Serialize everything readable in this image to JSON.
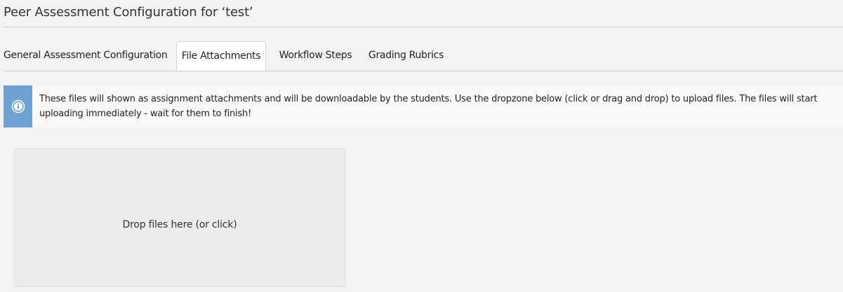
{
  "header": {
    "title": "Peer Assessment Configuration for ‘test’"
  },
  "tabs": [
    {
      "label": "General Assessment Configuration",
      "active": false
    },
    {
      "label": "File Attachments",
      "active": true
    },
    {
      "label": "Workflow Steps",
      "active": false
    },
    {
      "label": "Grading Rubrics",
      "active": false
    }
  ],
  "info": {
    "icon": "info-icon",
    "text": "These files will shown as assignment attachments and will be downloadable by the students. Use the dropzone below (click or drag and drop) to upload files. The files will start uploading immediately - wait for them to finish!"
  },
  "dropzone": {
    "label": "Drop files here (or click)"
  },
  "colors": {
    "info_accent": "#6ea2d2",
    "background": "#f3f3f3"
  }
}
